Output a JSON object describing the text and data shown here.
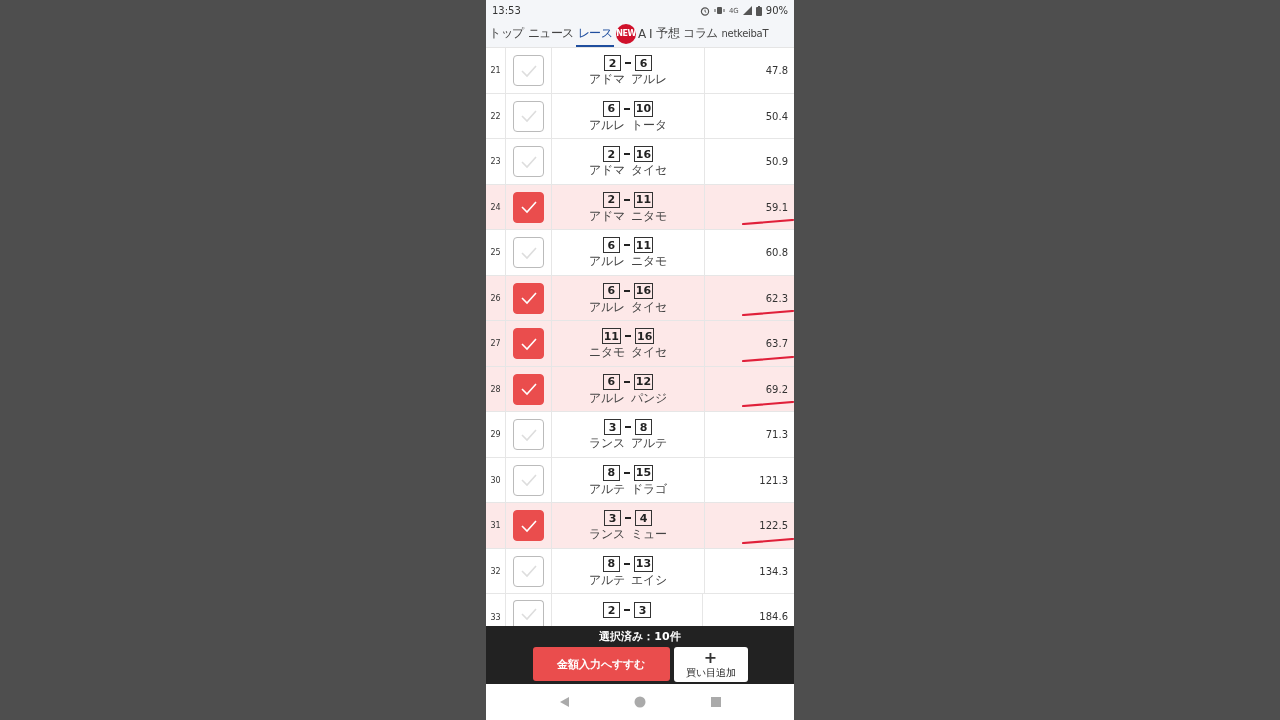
{
  "status_bar": {
    "time": "13:53",
    "network": "4G",
    "battery": "90%"
  },
  "tabs": [
    {
      "label": "トップ",
      "selected": false
    },
    {
      "label": "ニュース",
      "selected": false
    },
    {
      "label": "レース",
      "selected": true
    },
    {
      "label": "A I",
      "selected": false,
      "badge": "NEW"
    },
    {
      "label": "予想",
      "selected": false
    },
    {
      "label": "コラム",
      "selected": false
    },
    {
      "label": "netkeibaT",
      "selected": false
    }
  ],
  "rows": [
    {
      "no": "21",
      "checked": false,
      "pair": [
        "2",
        "6"
      ],
      "names": [
        "アドマ",
        "アルレ"
      ],
      "odds": "47.8",
      "underlined": false
    },
    {
      "no": "22",
      "checked": false,
      "pair": [
        "6",
        "10"
      ],
      "names": [
        "アルレ",
        "トータ"
      ],
      "odds": "50.4",
      "underlined": false
    },
    {
      "no": "23",
      "checked": false,
      "pair": [
        "2",
        "16"
      ],
      "names": [
        "アドマ",
        "タイセ"
      ],
      "odds": "50.9",
      "underlined": false
    },
    {
      "no": "24",
      "checked": true,
      "pair": [
        "2",
        "11"
      ],
      "names": [
        "アドマ",
        "ニタモ"
      ],
      "odds": "59.1",
      "underlined": true
    },
    {
      "no": "25",
      "checked": false,
      "pair": [
        "6",
        "11"
      ],
      "names": [
        "アルレ",
        "ニタモ"
      ],
      "odds": "60.8",
      "underlined": false
    },
    {
      "no": "26",
      "checked": true,
      "pair": [
        "6",
        "16"
      ],
      "names": [
        "アルレ",
        "タイセ"
      ],
      "odds": "62.3",
      "underlined": true
    },
    {
      "no": "27",
      "checked": true,
      "pair": [
        "11",
        "16"
      ],
      "names": [
        "ニタモ",
        "タイセ"
      ],
      "odds": "63.7",
      "underlined": true
    },
    {
      "no": "28",
      "checked": true,
      "pair": [
        "6",
        "12"
      ],
      "names": [
        "アルレ",
        "パンジ"
      ],
      "odds": "69.2",
      "underlined": true
    },
    {
      "no": "29",
      "checked": false,
      "pair": [
        "3",
        "8"
      ],
      "names": [
        "ランス",
        "アルテ"
      ],
      "odds": "71.3",
      "underlined": false
    },
    {
      "no": "30",
      "checked": false,
      "pair": [
        "8",
        "15"
      ],
      "names": [
        "アルテ",
        "ドラゴ"
      ],
      "odds": "121.3",
      "underlined": false
    },
    {
      "no": "31",
      "checked": true,
      "pair": [
        "3",
        "4"
      ],
      "names": [
        "ランス",
        "ミュー"
      ],
      "odds": "122.5",
      "underlined": true
    },
    {
      "no": "32",
      "checked": false,
      "pair": [
        "8",
        "13"
      ],
      "names": [
        "アルテ",
        "エイシ"
      ],
      "odds": "134.3",
      "underlined": false
    },
    {
      "no": "33",
      "checked": false,
      "pair": [
        "2",
        "3"
      ],
      "odds": "184.6",
      "underlined": false
    }
  ],
  "selection_bar": {
    "summary": "選択済み：10件",
    "primary_button": "金額入力へすすむ",
    "add_button": {
      "icon": "+",
      "label": "買い目追加"
    }
  }
}
